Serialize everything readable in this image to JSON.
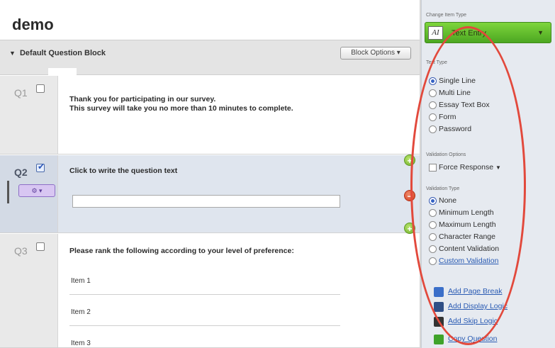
{
  "survey": {
    "title": "demo"
  },
  "block": {
    "title": "Default Question Block",
    "options_label": "Block Options ▾"
  },
  "questions": [
    {
      "number": "Q1",
      "text_line1": "Thank you for participating in our survey.",
      "text_line2": "This survey will take you no more than 10 minutes to complete."
    },
    {
      "number": "Q2",
      "text": "Click to write the question text",
      "gear_label": "⚙ ▾"
    },
    {
      "number": "Q3",
      "text": "Please rank the following according to your level of preference:",
      "items": [
        "Item 1",
        "Item 2",
        "Item 3"
      ]
    }
  ],
  "panel": {
    "change_type_label": "Change Item Type",
    "item_type": "Text Entry",
    "item_type_icon": "AI",
    "text_type_label": "Text Type",
    "text_types": [
      "Single Line",
      "Multi Line",
      "Essay Text Box",
      "Form",
      "Password"
    ],
    "validation_options_label": "Validation Options",
    "force_response": "Force Response",
    "validation_type_label": "Validation Type",
    "validation_types": [
      "None",
      "Minimum Length",
      "Maximum Length",
      "Character Range",
      "Content Validation"
    ],
    "custom_validation": "Custom Validation",
    "actions": [
      "Add Page Break",
      "Add Display Logic",
      "Add Skip Logic",
      "Copy Question"
    ]
  },
  "colors": {
    "item_type_green": "#5fc02a",
    "annotation_red": "#e2493c",
    "link_blue": "#2a5bb3"
  }
}
